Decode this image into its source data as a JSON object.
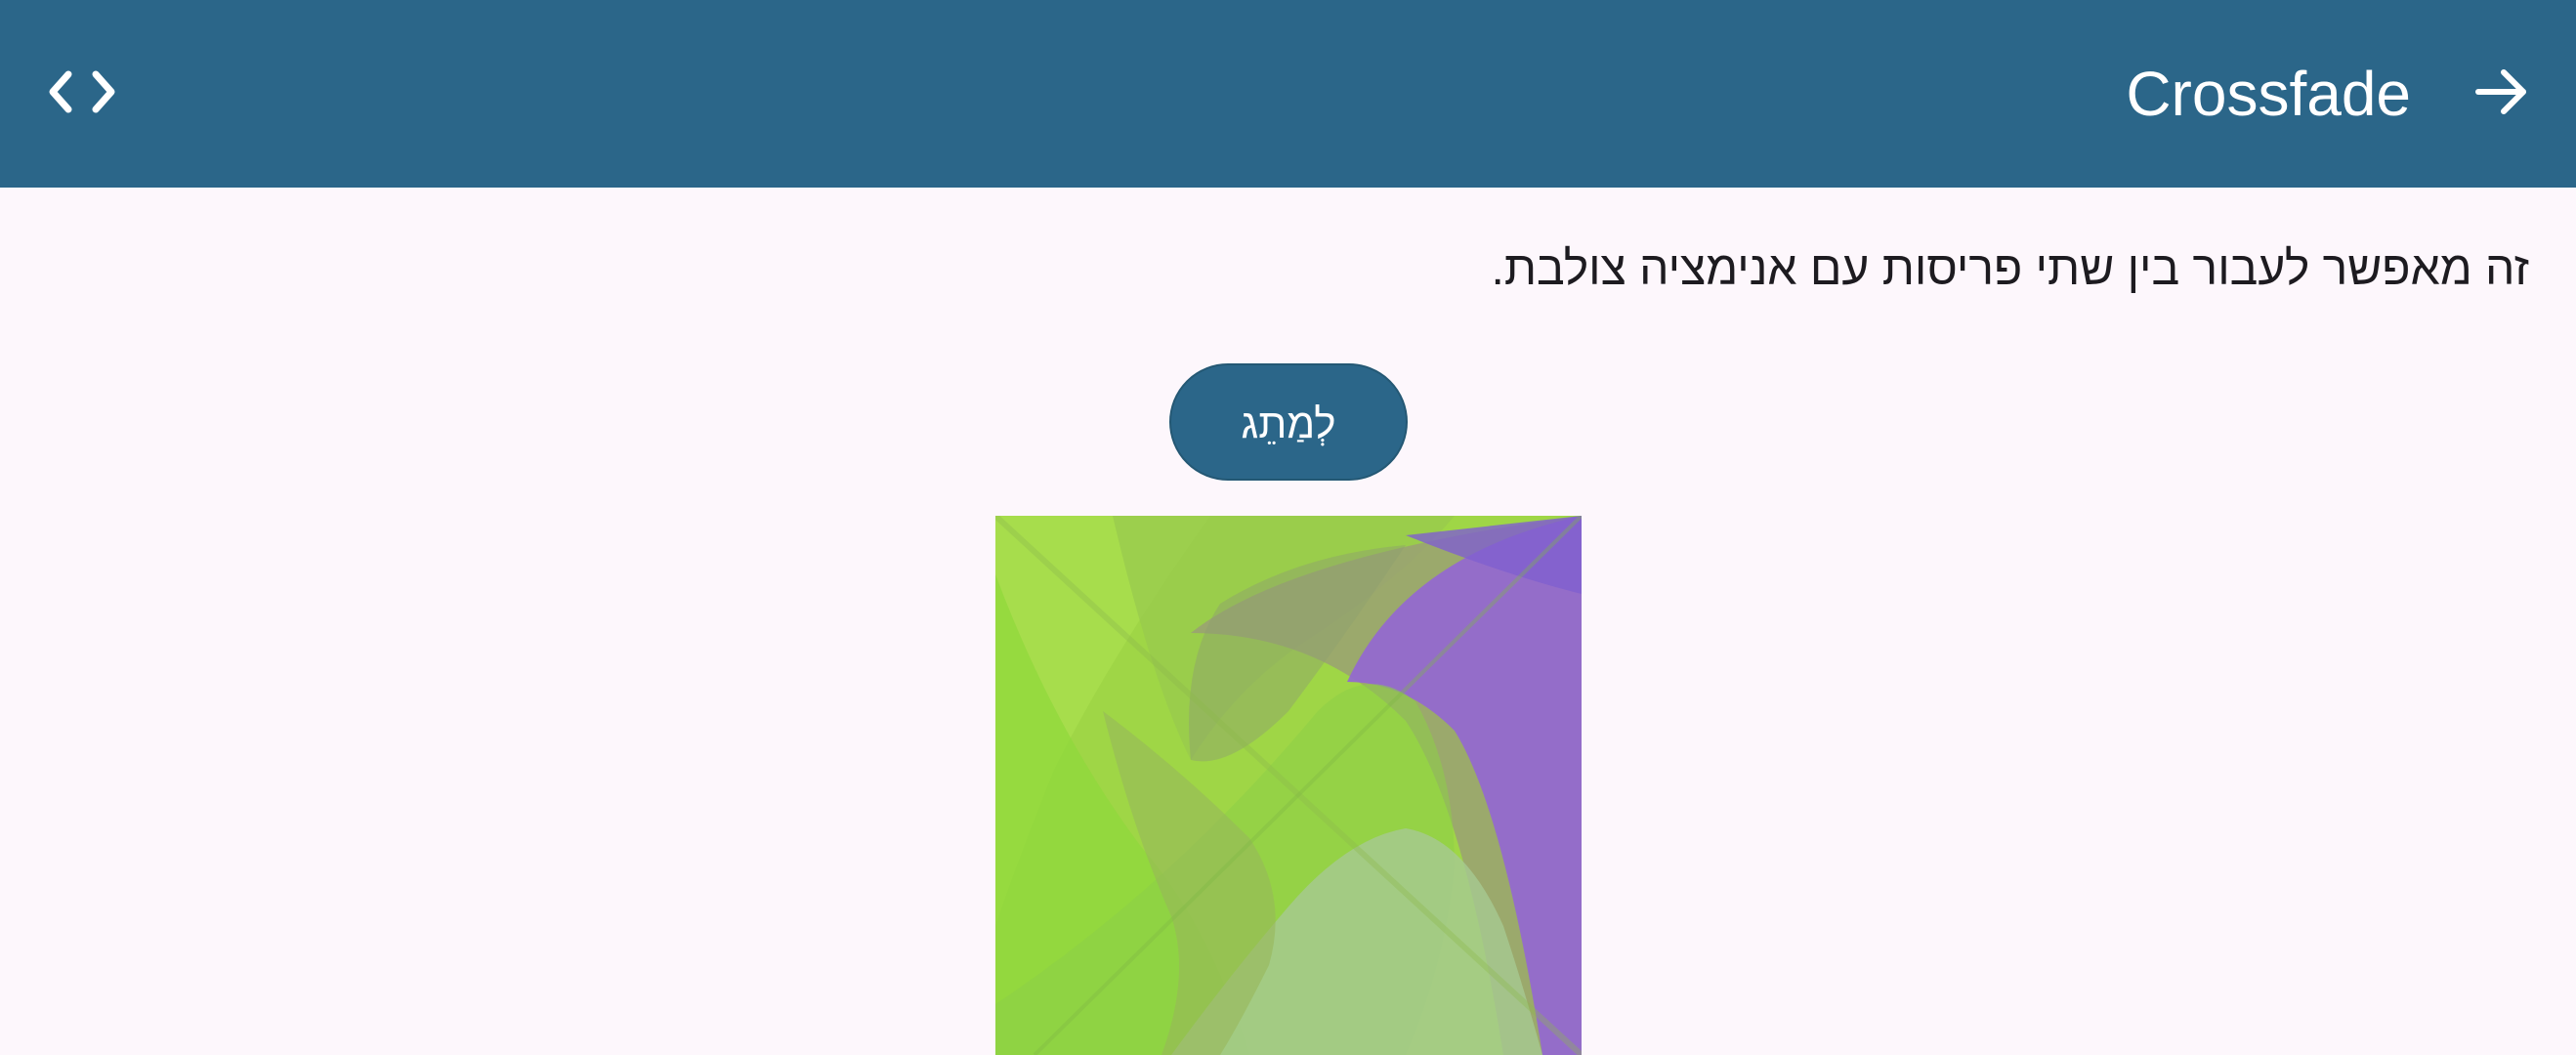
{
  "app_bar": {
    "title": "Crossfade",
    "left_icon": "code-icon",
    "right_icon": "arrow-forward-icon",
    "background_color": "#2b6689",
    "foreground_color": "#ffffff"
  },
  "content": {
    "description": "זה מאפשר לעבור בין שתי פריסות עם אנימציה צולבת.",
    "toggle_button_label": "לְמַתֵג",
    "button_color": "#2b6689"
  },
  "image": {
    "name": "crossfade-layout-image",
    "colors": [
      "#9bd23f",
      "#8fd93a",
      "#9a9a7a",
      "#9466d4",
      "#7f5fd0"
    ]
  },
  "page": {
    "background_color": "#fdf7fc",
    "text_color": "#1d1b20"
  }
}
